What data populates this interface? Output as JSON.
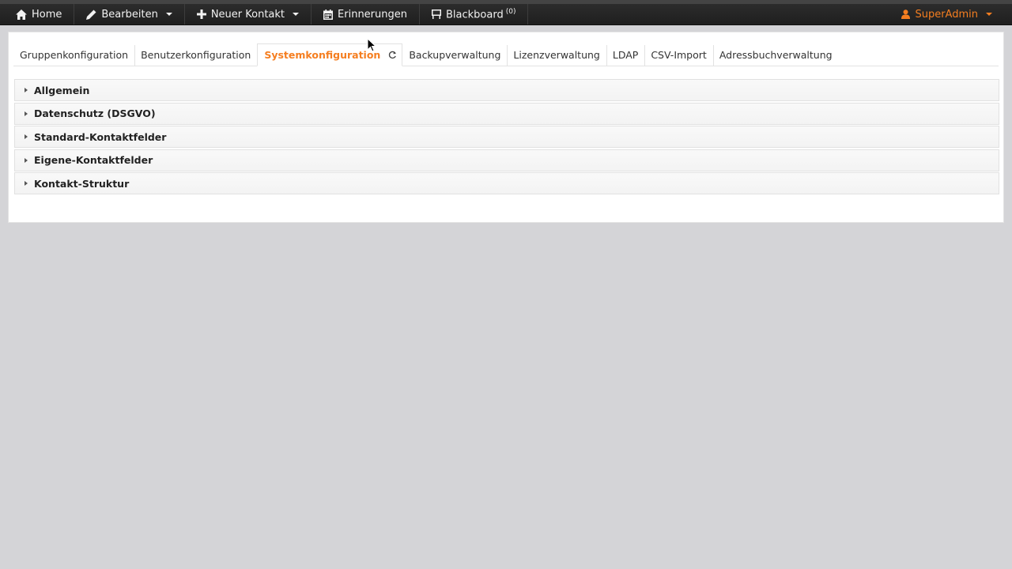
{
  "navbar": {
    "items": [
      {
        "label": "Home",
        "icon": "home-icon"
      },
      {
        "label": "Bearbeiten",
        "icon": "pencil-icon"
      },
      {
        "label": "Neuer Kontakt",
        "icon": "plus-icon"
      },
      {
        "label": "Erinnerungen",
        "icon": "calendar-icon"
      },
      {
        "label": "Blackboard",
        "icon": "blackboard-icon",
        "count": "(0)"
      }
    ],
    "user": {
      "label": "SuperAdmin",
      "icon": "user-icon",
      "color": "#f57e20"
    }
  },
  "tabs": [
    {
      "label": "Gruppenkonfiguration"
    },
    {
      "label": "Benutzerkonfiguration"
    },
    {
      "label": "Systemkonfiguration",
      "active": true
    },
    {
      "label": "Backupverwaltung"
    },
    {
      "label": "Lizenzverwaltung"
    },
    {
      "label": "LDAP"
    },
    {
      "label": "CSV-Import"
    },
    {
      "label": "Adressbuchverwaltung"
    }
  ],
  "sections": [
    {
      "label": "Allgemein"
    },
    {
      "label": "Datenschutz (DSGVO)"
    },
    {
      "label": "Standard-Kontaktfelder"
    },
    {
      "label": "Eigene-Kontaktfelder"
    },
    {
      "label": "Kontakt-Struktur"
    }
  ],
  "colors": {
    "accent": "#f57e20",
    "navbar": "#232323",
    "background": "#d4d4d7"
  }
}
